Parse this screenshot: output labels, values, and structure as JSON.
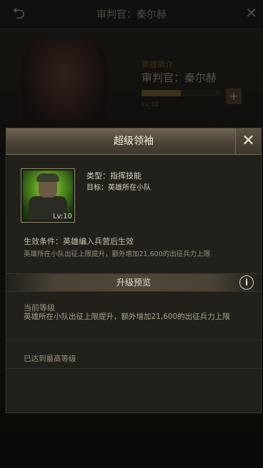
{
  "background": {
    "title": "审判官：秦尔赫",
    "rank_label": "英雄简介",
    "hero_name": "审判官：秦尔赫",
    "level_text": "Lv.30",
    "plus_label": "+",
    "back_icon": "back-arrow-icon",
    "close_icon": "close-icon"
  },
  "modal": {
    "title": "超级领袖",
    "close_label": "✕",
    "hero_level": "Lv:10",
    "type_text": "类型：指挥技能",
    "target_text": "目标：英雄所在小队",
    "condition_text": "生效条件：英雄编入兵营后生效",
    "condition_desc": "英雄所在小队出征上限提升，额外增加21,600的出征兵力上限",
    "section_title": "升级预览",
    "info_label": "i",
    "current_level_label": "当前等级",
    "current_level_desc": "英雄所在小队出征上限提升，额外增加21,600的出征兵力上限",
    "max_level_text": "已达到最高等级"
  },
  "colors": {
    "accent_gold": "#6f6551",
    "text_light": "#e4ddca",
    "panel_bg": "#22201b"
  }
}
